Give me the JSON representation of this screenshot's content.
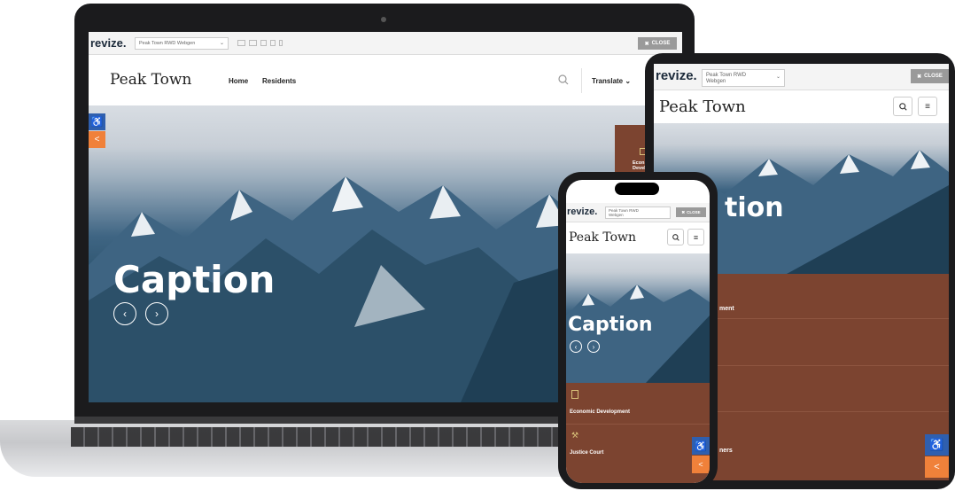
{
  "editor_bar": {
    "logo": "revize.",
    "site_select": "Peak Town RWD Webgen",
    "close_label": "CLOSE"
  },
  "site": {
    "title": "Peak Town",
    "nav": [
      "Home",
      "Residents"
    ],
    "translate": "Translate",
    "caption": "Caption",
    "caption_partial": "tion"
  },
  "quicklinks": [
    {
      "label": "Economic Development",
      "short": "Econ Devel"
    },
    {
      "label": "Justice Court"
    }
  ],
  "tablet_partial_labels": [
    "ment",
    "ners"
  ],
  "colors": {
    "brand_brown": "#7c4430",
    "access_blue": "#2f5fae",
    "share_orange": "#f0813a",
    "close_gray": "#9a9a9a"
  }
}
